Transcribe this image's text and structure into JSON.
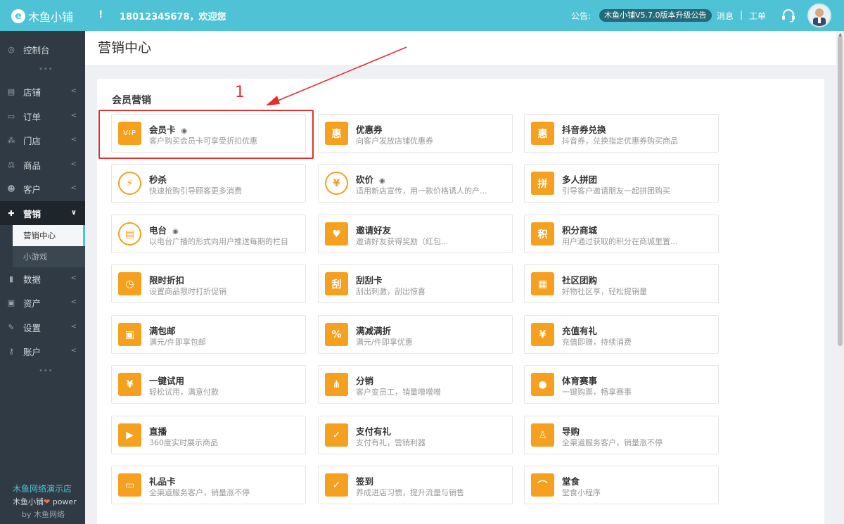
{
  "topbar": {
    "logo_text": "木鱼小铺",
    "alert": "!",
    "welcome": "18012345678，欢迎您",
    "notice_label": "公告:",
    "notice_text": "木鱼小铺V5.7.0版本升级公告",
    "messages": "消息",
    "separator": "|",
    "workorder": "工单"
  },
  "sidebar": {
    "items": [
      {
        "label": "控制台",
        "icon": "dashboard-icon"
      },
      {
        "label": "店铺",
        "icon": "store-icon"
      },
      {
        "label": "订单",
        "icon": "order-icon"
      },
      {
        "label": "门店",
        "icon": "branch-icon"
      },
      {
        "label": "商品",
        "icon": "goods-icon"
      },
      {
        "label": "客户",
        "icon": "customer-icon"
      },
      {
        "label": "营销",
        "icon": "gift-icon"
      },
      {
        "label": "数据",
        "icon": "chart-icon"
      },
      {
        "label": "资产",
        "icon": "asset-icon"
      },
      {
        "label": "设置",
        "icon": "wrench-icon"
      },
      {
        "label": "账户",
        "icon": "key-icon"
      }
    ],
    "sub_items": [
      "营销中心",
      "小游戏"
    ],
    "footer_title": "木鱼网络演示店",
    "footer_power_brand": "木鱼小铺",
    "footer_power": "power",
    "footer_by": "by 木鱼网络"
  },
  "page": {
    "title": "营销中心",
    "section_title": "会员营销",
    "annotation_number": "1"
  },
  "cards": [
    {
      "name": "会员卡",
      "desc": "客户购买会员卡可享受折扣优惠",
      "icon": "vip-card-icon",
      "glyph": "VIP",
      "eye": true
    },
    {
      "name": "优惠券",
      "desc": "向客户发放店铺优惠券",
      "icon": "coupon-icon",
      "glyph": "惠",
      "eye": false
    },
    {
      "name": "抖音券兑换",
      "desc": "抖音券，兑换指定优惠券购买商品",
      "icon": "douyin-coupon-icon",
      "glyph": "惠",
      "eye": false
    },
    {
      "name": "秒杀",
      "desc": "快速抢购引导顾客更多消费",
      "icon": "lightning-icon",
      "glyph": "⚡",
      "eye": false
    },
    {
      "name": "砍价",
      "desc": "适用新店宣传，用一款价格诱人的产...",
      "icon": "bargain-icon",
      "glyph": "¥",
      "eye": true
    },
    {
      "name": "多人拼团",
      "desc": "引导客户邀请朋友一起拼团购买",
      "icon": "group-buy-icon",
      "glyph": "拼",
      "eye": false
    },
    {
      "name": "电台",
      "desc": "以电台广播的形式向用户推送每期的栏目",
      "icon": "radio-icon",
      "glyph": "▤",
      "eye": true
    },
    {
      "name": "邀请好友",
      "desc": "邀请好友获得奖励（红包...",
      "icon": "invite-icon",
      "glyph": "♥",
      "eye": false
    },
    {
      "name": "积分商城",
      "desc": "用户通过获取的积分在商城里置...",
      "icon": "points-icon",
      "glyph": "积",
      "eye": false
    },
    {
      "name": "限时折扣",
      "desc": "设置商品限时打折促销",
      "icon": "clock-icon",
      "glyph": "◷",
      "eye": false
    },
    {
      "name": "刮刮卡",
      "desc": "刮出刺激，刮出惊喜",
      "icon": "scratch-card-icon",
      "glyph": "刮",
      "eye": false
    },
    {
      "name": "社区团购",
      "desc": "好物社区享，轻松提销量",
      "icon": "building-icon",
      "glyph": "▦",
      "eye": false
    },
    {
      "name": "满包邮",
      "desc": "满元/件即享包邮",
      "icon": "package-icon",
      "glyph": "▣",
      "eye": false
    },
    {
      "name": "满减满折",
      "desc": "满元/件即享优惠",
      "icon": "percent-icon",
      "glyph": "%",
      "eye": false
    },
    {
      "name": "充值有礼",
      "desc": "充值即赠，持续消费",
      "icon": "moneybag-icon",
      "glyph": "¥",
      "eye": false
    },
    {
      "name": "一键试用",
      "desc": "轻松试用，满意付款",
      "icon": "trial-bag-icon",
      "glyph": "¥",
      "eye": false
    },
    {
      "name": "分销",
      "desc": "客户变员工，销量噌噌噌",
      "icon": "distribution-icon",
      "glyph": "⋔",
      "eye": false
    },
    {
      "name": "体育赛事",
      "desc": "一键购票，畅享赛事",
      "icon": "basketball-icon",
      "glyph": "●",
      "eye": false
    },
    {
      "name": "直播",
      "desc": "360度实时展示商品",
      "icon": "tv-play-icon",
      "glyph": "▶",
      "eye": false
    },
    {
      "name": "支付有礼",
      "desc": "支付有礼，营销利器",
      "icon": "pay-gift-icon",
      "glyph": "✓",
      "eye": false
    },
    {
      "name": "导购",
      "desc": "全渠道服务客户，销量涨不停",
      "icon": "guide-icon",
      "glyph": "♙",
      "eye": false
    },
    {
      "name": "礼品卡",
      "desc": "全渠道服务客户，销量涨不停",
      "icon": "gift-card-icon",
      "glyph": "▭",
      "eye": false
    },
    {
      "name": "签到",
      "desc": "养成进店习惯，提升流量与销售",
      "icon": "calendar-check-icon",
      "glyph": "✓",
      "eye": false
    },
    {
      "name": "堂食",
      "desc": "堂食小程序",
      "icon": "dining-icon",
      "glyph": "⌒",
      "eye": false
    }
  ],
  "colors": {
    "topbar": "#4fc3d5",
    "sidebar": "#2f3a44",
    "accent_orange": "#f5a01f",
    "annotation_red": "#e23030"
  }
}
